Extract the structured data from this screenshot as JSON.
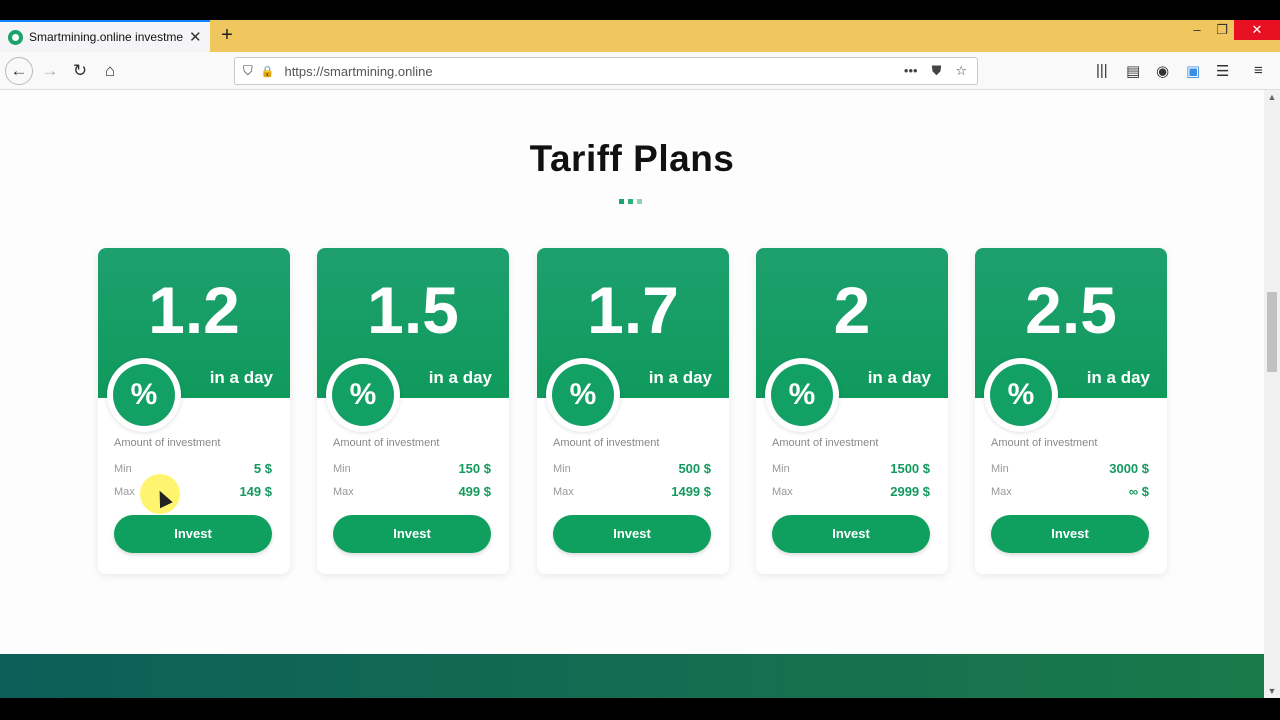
{
  "browser": {
    "tab_title": "Smartmining.online investmen",
    "tab_close": "✕",
    "new_tab": "+",
    "url": "https://smartmining.online",
    "window_controls": {
      "minimize": "–",
      "restore": "❐",
      "close": "✕"
    },
    "nav": {
      "back": "←",
      "forward": "→",
      "reload": "↻",
      "home": "⌂"
    },
    "url_icons": {
      "shield": "⛉",
      "lock": "🔒",
      "more": "•••",
      "pocket": "⛊",
      "bookmark": "☆"
    },
    "toolbar_icons": {
      "library": "|||",
      "sidebar": "▤",
      "account": "◉",
      "extension": "▣",
      "menu_bars": "☰",
      "hamburger": "≡"
    }
  },
  "section": {
    "title": "Tariff Plans"
  },
  "plans": [
    {
      "rate": "1.2",
      "period": "in a day",
      "percent": "%",
      "amount_label": "Amount of investment",
      "min_label": "Min",
      "min_value": "5 $",
      "max_label": "Max",
      "max_value": "149 $",
      "button": "Invest"
    },
    {
      "rate": "1.5",
      "period": "in a day",
      "percent": "%",
      "amount_label": "Amount of investment",
      "min_label": "Min",
      "min_value": "150 $",
      "max_label": "Max",
      "max_value": "499 $",
      "button": "Invest"
    },
    {
      "rate": "1.7",
      "period": "in a day",
      "percent": "%",
      "amount_label": "Amount of investment",
      "min_label": "Min",
      "min_value": "500 $",
      "max_label": "Max",
      "max_value": "1499 $",
      "button": "Invest"
    },
    {
      "rate": "2",
      "period": "in a day",
      "percent": "%",
      "amount_label": "Amount of investment",
      "min_label": "Min",
      "min_value": "1500 $",
      "max_label": "Max",
      "max_value": "2999 $",
      "button": "Invest"
    },
    {
      "rate": "2.5",
      "period": "in a day",
      "percent": "%",
      "amount_label": "Amount of investment",
      "min_label": "Min",
      "min_value": "3000 $",
      "max_label": "Max",
      "max_value": "∞ $",
      "button": "Invest"
    }
  ],
  "colors": {
    "accent": "#0f9f5e",
    "tab_strip": "#efc75e",
    "footer_band": "#0d5e58"
  }
}
